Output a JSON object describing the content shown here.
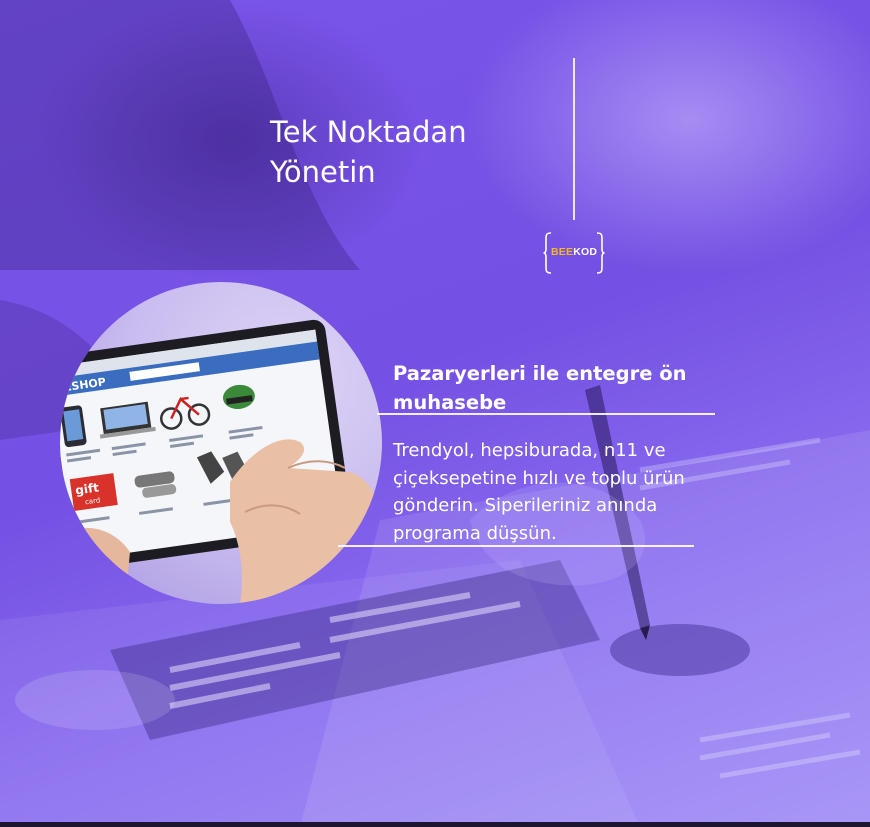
{
  "headline": {
    "line1": "Tek Noktadan",
    "line2": "Yönetin"
  },
  "logo": {
    "part1": "BEE",
    "part2": "KOD",
    "color_bee": "#f5b820",
    "color_kod": "#ffffff"
  },
  "photo": {
    "shop_title": "NESHOP",
    "gift_card_line1": "gift",
    "gift_card_line2": "card",
    "icon": "tablet-shop-photo"
  },
  "feature": {
    "title": "Pazaryerleri ile entegre ön muhasebe",
    "description": "Trendyol, hepsiburada, n11 ve çiçeksepetine hızlı ve toplu ürün gönderin. Siperileriniz anında programa düşsün."
  },
  "colors": {
    "background": "#7a55ea",
    "text": "#ffffff",
    "bottom_bar": "#1e1530"
  }
}
